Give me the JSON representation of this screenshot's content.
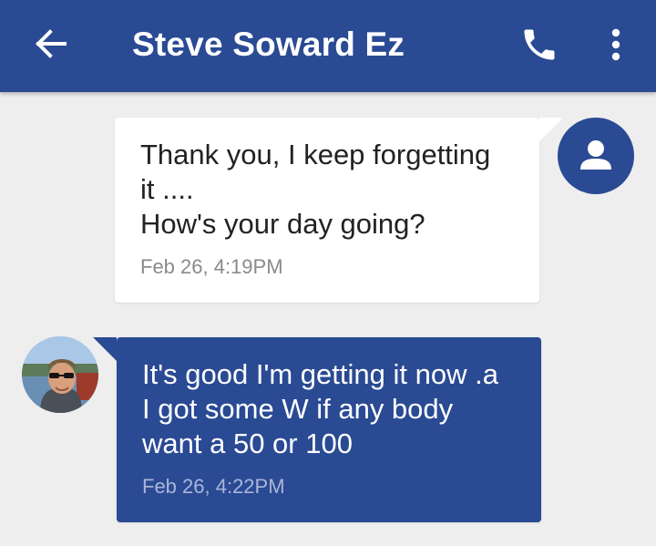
{
  "header": {
    "title": "Steve Soward Ez",
    "background_color": "#2a4a94",
    "back_icon": "arrow-back-icon",
    "call_icon": "phone-icon",
    "menu_icon": "more-vert-icon"
  },
  "conversation": {
    "messages": [
      {
        "direction": "outgoing",
        "text": "Thank you, I keep forgetting\nit ....\nHow's your day going?",
        "timestamp": "Feb 26, 4:19PM",
        "bubble_color": "#ffffff",
        "avatar": "default-person-icon"
      },
      {
        "direction": "incoming",
        "text": "It's good I'm getting it now .a\nI got some W if any body\nwant a 50 or 100",
        "timestamp": "Feb 26, 4:22PM",
        "bubble_color": "#2a4a94",
        "avatar": "contact-photo"
      }
    ]
  }
}
